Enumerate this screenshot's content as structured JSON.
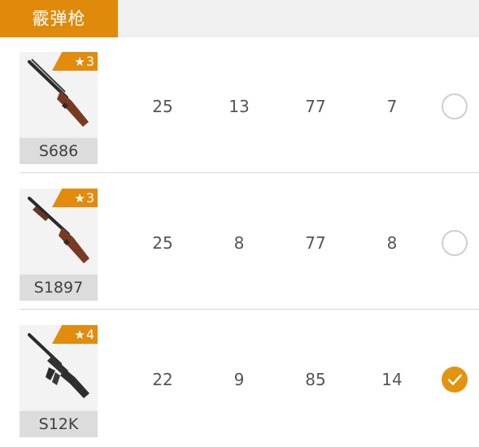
{
  "category_tab": {
    "label": "霰弹枪"
  },
  "weapons": [
    {
      "name": "S686",
      "stars": "3",
      "stats": [
        "25",
        "13",
        "77",
        "7"
      ],
      "selected": false,
      "icon": "double-barrel-shotgun-icon"
    },
    {
      "name": "S1897",
      "stars": "3",
      "stats": [
        "25",
        "8",
        "77",
        "8"
      ],
      "selected": false,
      "icon": "pump-shotgun-icon"
    },
    {
      "name": "S12K",
      "stars": "4",
      "stats": [
        "22",
        "9",
        "85",
        "14"
      ],
      "selected": true,
      "icon": "auto-shotgun-icon"
    }
  ],
  "colors": {
    "accent": "#e08a0b",
    "badge": "#e28b0d",
    "check": "#e4930f"
  }
}
